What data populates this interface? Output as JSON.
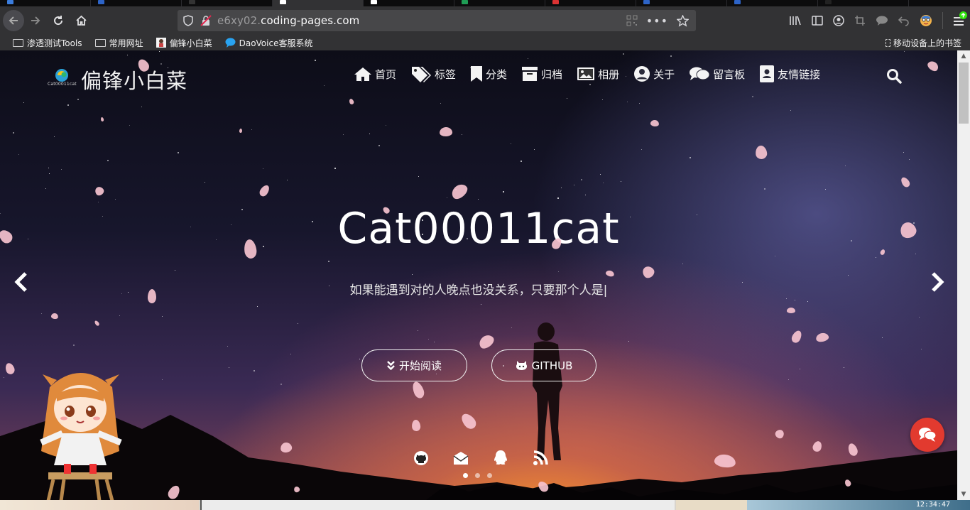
{
  "browser": {
    "url_host": "e6xy02.",
    "url_domain": "coding-pages.com",
    "bookmarks": [
      {
        "label": "渗透测试Tools",
        "icon": "folder-icon"
      },
      {
        "label": "常用网址",
        "icon": "folder-icon"
      },
      {
        "label": "偏锋小白菜",
        "icon": "site-favicon"
      },
      {
        "label": "DaoVoice客服系统",
        "icon": "chat-favicon"
      }
    ],
    "mobile_bookmarks": "移动设备上的书签"
  },
  "site": {
    "logo_text": "Cat00011cat",
    "title": "偏锋小白菜",
    "menu": [
      {
        "label": "首页",
        "icon": "home-icon"
      },
      {
        "label": "标签",
        "icon": "tags-icon"
      },
      {
        "label": "分类",
        "icon": "bookmark-icon"
      },
      {
        "label": "归档",
        "icon": "archive-icon"
      },
      {
        "label": "相册",
        "icon": "image-icon"
      },
      {
        "label": "关于",
        "icon": "user-circle-icon"
      },
      {
        "label": "留言板",
        "icon": "comments-icon"
      },
      {
        "label": "友情链接",
        "icon": "address-book-icon"
      }
    ]
  },
  "hero": {
    "title": "Cat00011cat",
    "subtitle": "如果能遇到对的人晚点也没关系，只要那个人是|",
    "read_button": "开始阅读",
    "github_button": "GITHUB",
    "social_icons": [
      "github-icon",
      "email-icon",
      "qq-icon",
      "rss-icon"
    ],
    "slides": 3,
    "active_slide": 1
  },
  "taskbar": {
    "clock": "12:34:47"
  },
  "colors": {
    "chat_bubble": "#e23a2f",
    "petal": "#f6c3cf",
    "chrome": "#323234"
  }
}
